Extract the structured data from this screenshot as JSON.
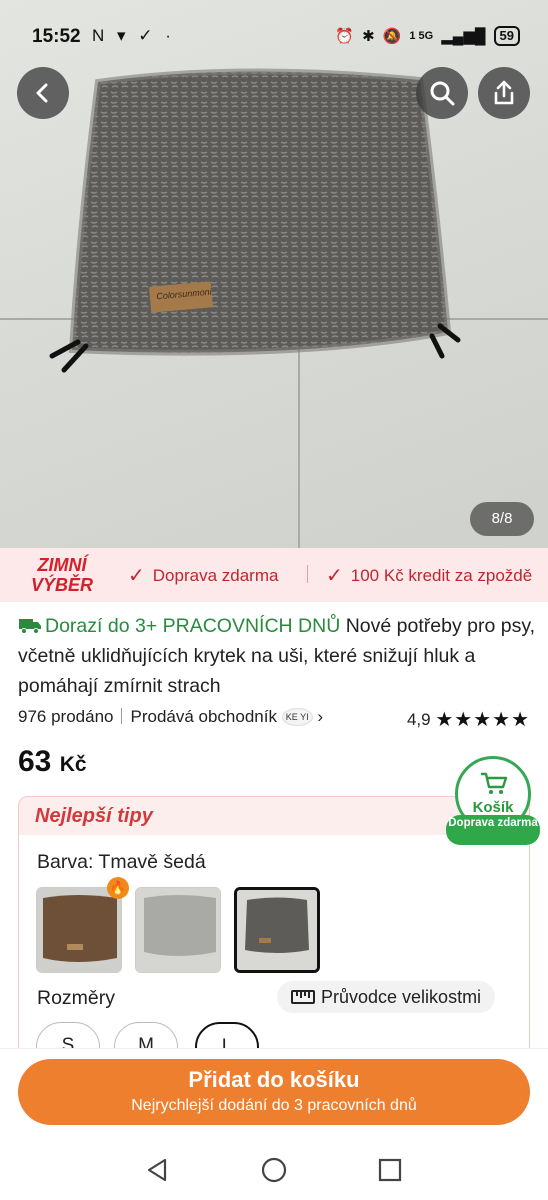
{
  "status": {
    "time": "15:52",
    "left_icons": "N ▾ ✓ ·",
    "network": "1 5G",
    "battery": "59"
  },
  "gallery": {
    "counter": "8/8",
    "brand_label": "Colorsunmoni"
  },
  "promo": {
    "logo_line1": "ZIMNÍ",
    "logo_line2": "VÝBĚR",
    "item1": "Doprava zdarma",
    "item2": "100 Kč kredit za zpoždě"
  },
  "product": {
    "delivery": "Dorazí do 3+ PRACOVNÍCH DNŮ",
    "title": "Nové potřeby pro psy, včetně uklidňujících krytek na uši, které snižují hluk a pomáhají zmírnit strach",
    "sold": "976 prodáno",
    "seller_prefix": "Prodává obchodník",
    "seller_badge": "KE YI",
    "rating": "4,9",
    "stars": "★★★★★",
    "price": "63",
    "currency": "Kč"
  },
  "cart_badge": {
    "label": "Košík",
    "pill": "Doprava zdarma"
  },
  "tips": {
    "heading": "Nejlepší tipy",
    "color_label": "Barva: Tmavě šedá",
    "sizes_label": "Rozměry",
    "size_guide": "Průvodce velikostmi",
    "sizes": [
      "S",
      "M",
      "L"
    ],
    "selected_size": "L",
    "swatches": [
      "brown",
      "light-gray",
      "dark-gray"
    ],
    "selected_swatch": "dark-gray"
  },
  "cta": {
    "label": "Přidat do košíku",
    "sublabel": "Nejrychlejší dodání do 3 pracovních dnů"
  },
  "colors": {
    "accent_orange": "#ee7f2f",
    "promo_red": "#c0262f",
    "delivery_green": "#2a8a3e"
  }
}
